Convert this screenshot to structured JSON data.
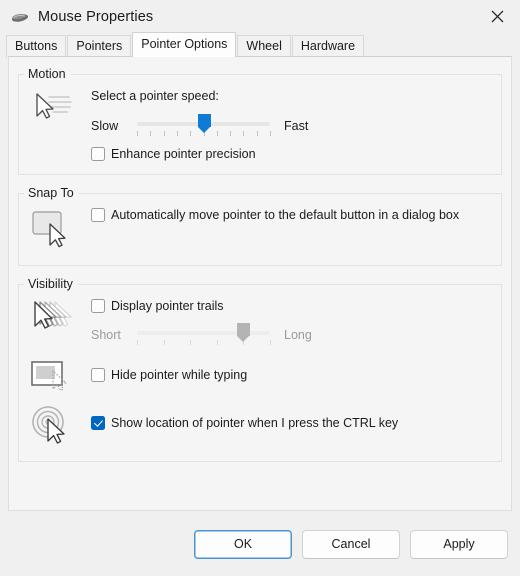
{
  "window": {
    "title": "Mouse Properties",
    "icon": "mouse-icon",
    "close_label": "✕"
  },
  "tabs": [
    {
      "label": "Buttons",
      "active": false
    },
    {
      "label": "Pointers",
      "active": false
    },
    {
      "label": "Pointer Options",
      "active": true
    },
    {
      "label": "Wheel",
      "active": false
    },
    {
      "label": "Hardware",
      "active": false
    }
  ],
  "motion": {
    "legend": "Motion",
    "icon": "pointer-motion-icon",
    "caption": "Select a pointer speed:",
    "slider": {
      "min_label": "Slow",
      "max_label": "Fast",
      "value_percent": 50,
      "ticks": 11,
      "enabled": true
    },
    "enhance_precision": {
      "label": "Enhance pointer precision",
      "checked": false
    }
  },
  "snap_to": {
    "legend": "Snap To",
    "icon": "default-button-pointer-icon",
    "auto_move": {
      "label": "Automatically move pointer to the default button in a dialog box",
      "checked": false
    }
  },
  "visibility": {
    "legend": "Visibility",
    "trails": {
      "icon": "pointer-trails-icon",
      "label": "Display pointer trails",
      "checked": false,
      "slider": {
        "min_label": "Short",
        "max_label": "Long",
        "value_percent": 80,
        "ticks": 6,
        "enabled": false
      }
    },
    "hide_typing": {
      "icon": "hide-pointer-typing-icon",
      "label": "Hide pointer while typing",
      "checked": false
    },
    "show_location": {
      "icon": "pointer-location-ripple-icon",
      "label": "Show location of pointer when I press the CTRL key",
      "checked": true
    }
  },
  "footer": {
    "ok": "OK",
    "cancel": "Cancel",
    "apply": "Apply"
  },
  "colors": {
    "accent": "#0067c0",
    "slider_accent": "#0f7bd4",
    "window_bg": "#f0f0f0",
    "page_bg": "#f5f5f5"
  }
}
